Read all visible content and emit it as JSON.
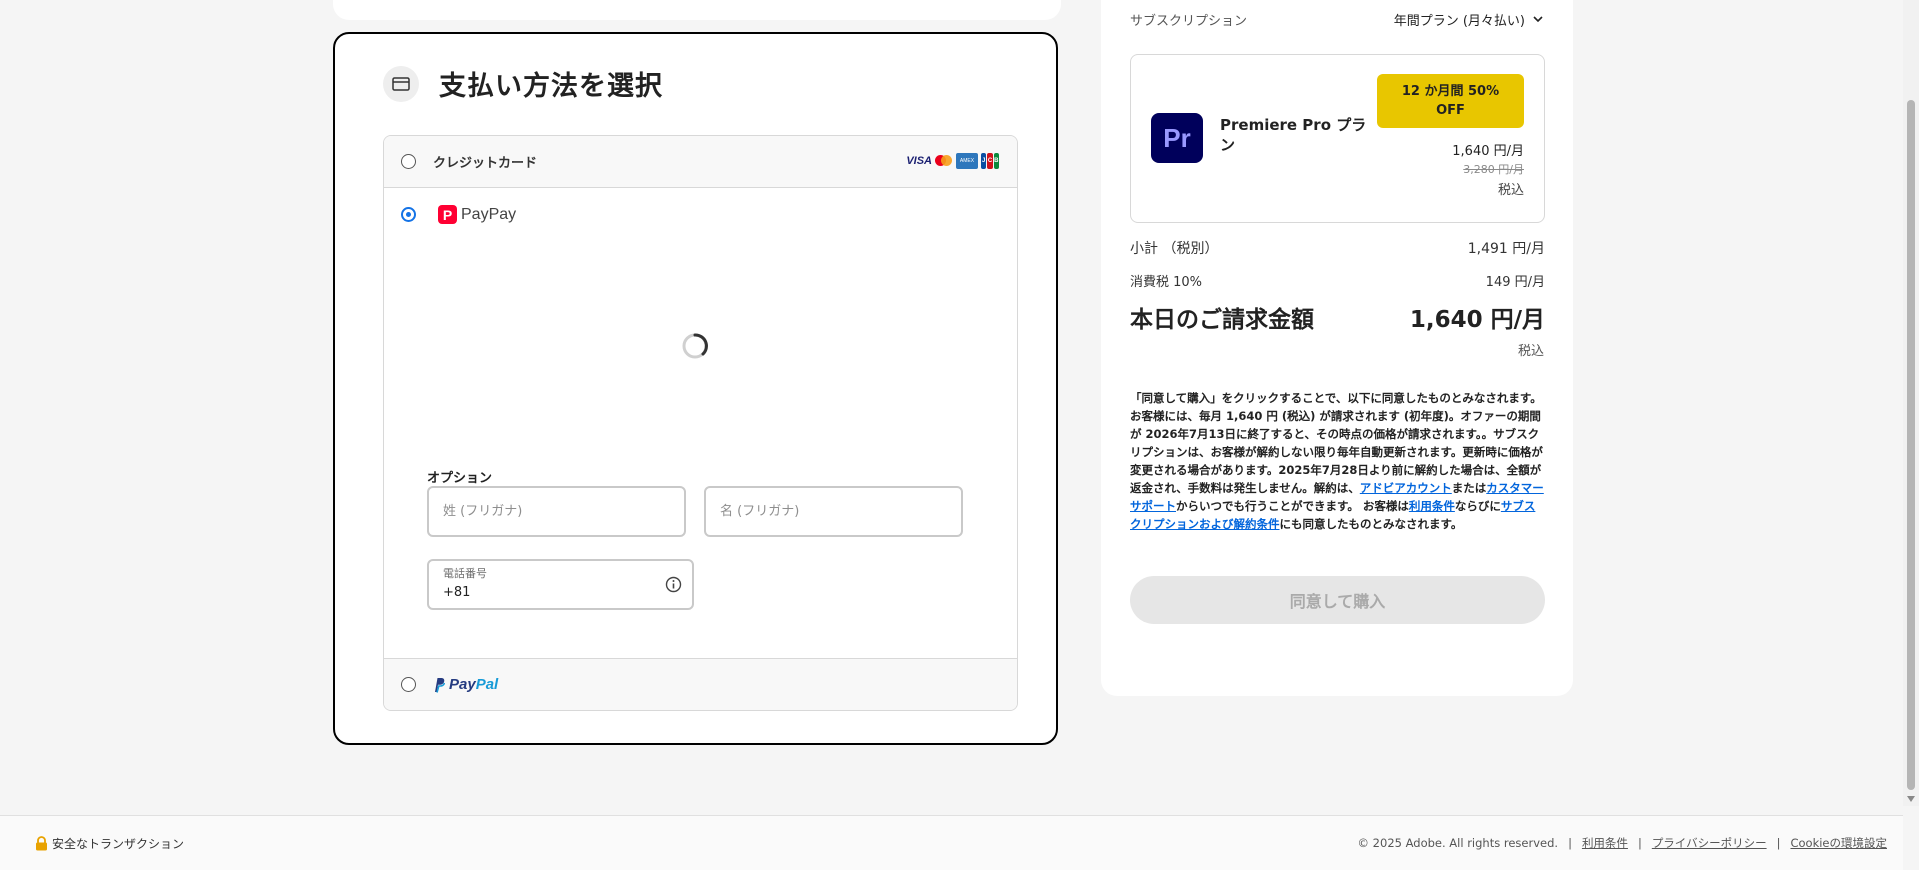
{
  "payment": {
    "title": "支払い方法を選択",
    "methods": {
      "credit_card_label": "クレジットカード",
      "card_brands": [
        "VISA",
        "Mastercard",
        "American Express",
        "JCB"
      ],
      "paypay_label": "PayPay",
      "paypal_label_1": "Pay",
      "paypal_label_2": "Pal"
    },
    "options_label": "オプション",
    "lastname_placeholder": "姓 (フリガナ)",
    "firstname_placeholder": "名 (フリガナ)",
    "phone_label": "電話番号",
    "phone_value": "+81"
  },
  "summary": {
    "subscription_label": "サブスクリプション",
    "subscription_plan": "年間プラン (月々払い)",
    "product_name": "Premiere Pro プラン",
    "product_icon_text": "Pr",
    "promo_badge": "12 か月間 50% OFF",
    "price_now": "1,640 円/月",
    "price_old": "3,280 円/月",
    "tax_included": "税込",
    "subtotal_label": "小計 （税別）",
    "subtotal_value": "1,491 円/月",
    "tax_label": "消費税 10%",
    "tax_value": "149 円/月",
    "total_label": "本日のご請求金額",
    "total_value": "1,640 円/月",
    "total_tax_note": "税込",
    "legal": {
      "part1": "「同意して購入」をクリックすることで、以下に同意したものとみなされます。お客様には、毎月 1,640 円 (税込) が請求されます (初年度)。オファーの期間が 2026年7月13日に終了すると、その時点の価格が請求されます。。サブスクリプションは、お客様が解約しない限り毎年自動更新されます。更新時に価格が変更される場合があります。2025年7月28日より前に解約した場合は、全額が返金され、手数料は発生しません。解約は、",
      "link_account": "アドビアカウント",
      "part2": "または",
      "link_support": "カスタマーサポート",
      "part3": "からいつでも行うことができます。 お客様は",
      "link_terms": "利用条件",
      "part4": "ならびに",
      "link_subscription_terms": "サブスクリプションおよび解約条件",
      "part5": "にも同意したものとみなされます。"
    },
    "buy_button": "同意して購入"
  },
  "footer": {
    "secure": "安全なトランザクション",
    "copyright": "© 2025 Adobe. All rights reserved.",
    "terms": "利用条件",
    "privacy": "プライバシーポリシー",
    "cookie": "Cookieの環境設定"
  },
  "colors": {
    "accent_blue": "#1473e6",
    "link_blue": "#0265dc",
    "promo_yellow": "#e8c600",
    "premiere_bg": "#00005b",
    "premiere_fg": "#9999ff",
    "paypay_red": "#ff0033"
  }
}
